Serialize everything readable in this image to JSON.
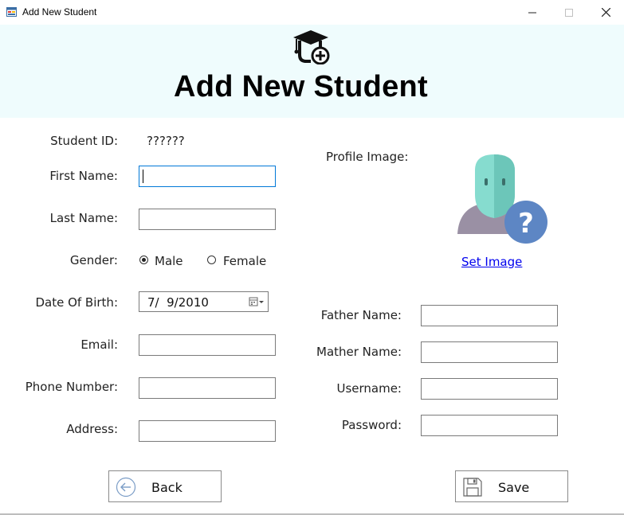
{
  "window": {
    "title": "Add New Student",
    "controls": {
      "minimize": "—",
      "maximize": "☐",
      "close": "✕"
    },
    "app_icon": "form-app-icon"
  },
  "header": {
    "title": "Add New Student",
    "icon": "graduation-cap-add-icon"
  },
  "form": {
    "student_id": {
      "label": "Student ID:",
      "value": "??????"
    },
    "first_name": {
      "label": "First Name:",
      "value": ""
    },
    "last_name": {
      "label": "Last Name:",
      "value": ""
    },
    "gender": {
      "label": "Gender:",
      "options": [
        {
          "label": "Male",
          "checked": true
        },
        {
          "label": "Female",
          "checked": false
        }
      ]
    },
    "date_of_birth": {
      "label": "Date Of Birth:",
      "value": "7/  9/2010"
    },
    "email": {
      "label": "Email:",
      "value": ""
    },
    "phone_number": {
      "label": "Phone Number:",
      "value": ""
    },
    "address": {
      "label": "Address:",
      "value": ""
    },
    "profile_image": {
      "label": "Profile Image:",
      "link": "Set Image",
      "icon": "unknown-user-icon"
    },
    "father_name": {
      "label": "Father Name:",
      "value": ""
    },
    "mother_name": {
      "label": "Mather Name:",
      "value": ""
    },
    "username": {
      "label": "Username:",
      "value": ""
    },
    "password": {
      "label": "Password:",
      "value": ""
    }
  },
  "buttons": {
    "back": {
      "label": "Back",
      "icon": "arrow-left-circle-icon"
    },
    "save": {
      "label": "Save",
      "icon": "floppy-disk-icon"
    }
  },
  "colors": {
    "header_bg": "#effcfd",
    "focus_border": "#0078d7",
    "link": "#0000ee"
  }
}
